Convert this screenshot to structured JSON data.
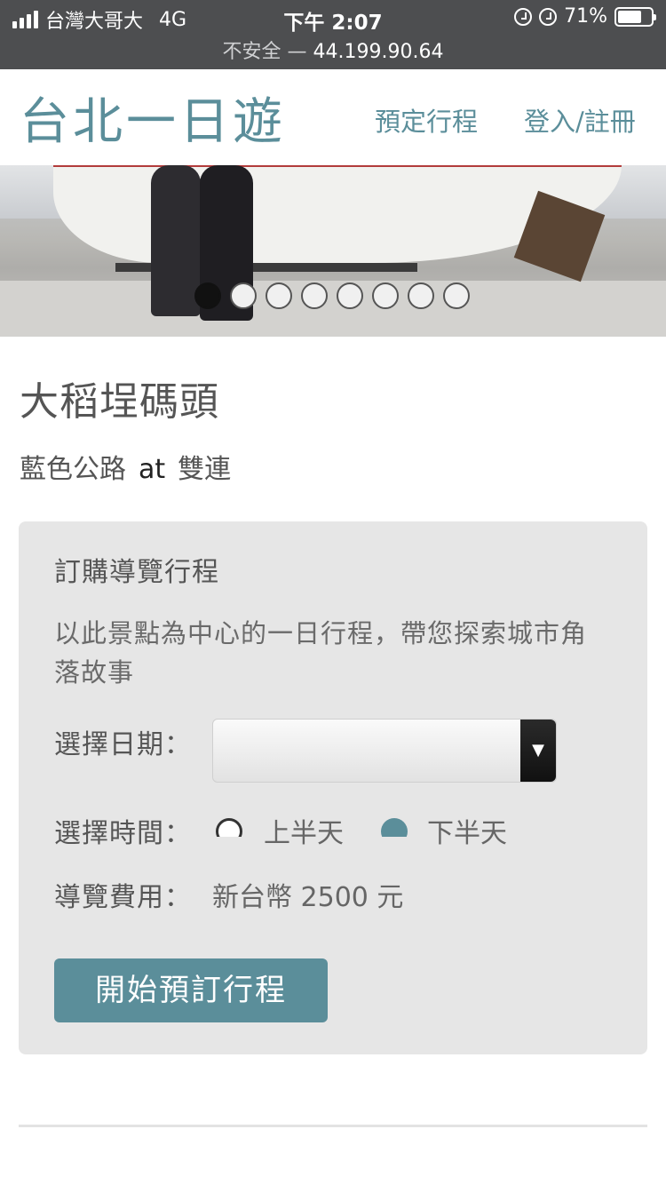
{
  "status_bar": {
    "carrier": "台灣大哥大",
    "network": "4G",
    "time": "下午 2:07",
    "battery": "71%",
    "battery_level": 0.71,
    "url_prefix": "不安全 —",
    "url_host": "44.199.90.64"
  },
  "header": {
    "title": "台北一日遊",
    "nav": {
      "book": "預定行程",
      "login": "登入/註冊"
    }
  },
  "carousel": {
    "slide_count": 8,
    "active_index": 0
  },
  "place": {
    "name": "大稻埕碼頭",
    "route": "藍色公路",
    "at": "at",
    "area": "雙連"
  },
  "booking": {
    "title": "訂購導覽行程",
    "description": "以此景點為中心的一日行程，帶您探索城市角落故事",
    "date_label": "選擇日期：",
    "date_value": "",
    "time_label": "選擇時間：",
    "time_options": [
      "上半天",
      "下半天"
    ],
    "fee_label": "導覽費用：",
    "fee_value": "新台幣 2500 元",
    "submit": "開始預訂行程"
  },
  "colors": {
    "accent": "#5b8e9a",
    "status_bar": "#4d4e50",
    "card": "#e6e6e6"
  }
}
